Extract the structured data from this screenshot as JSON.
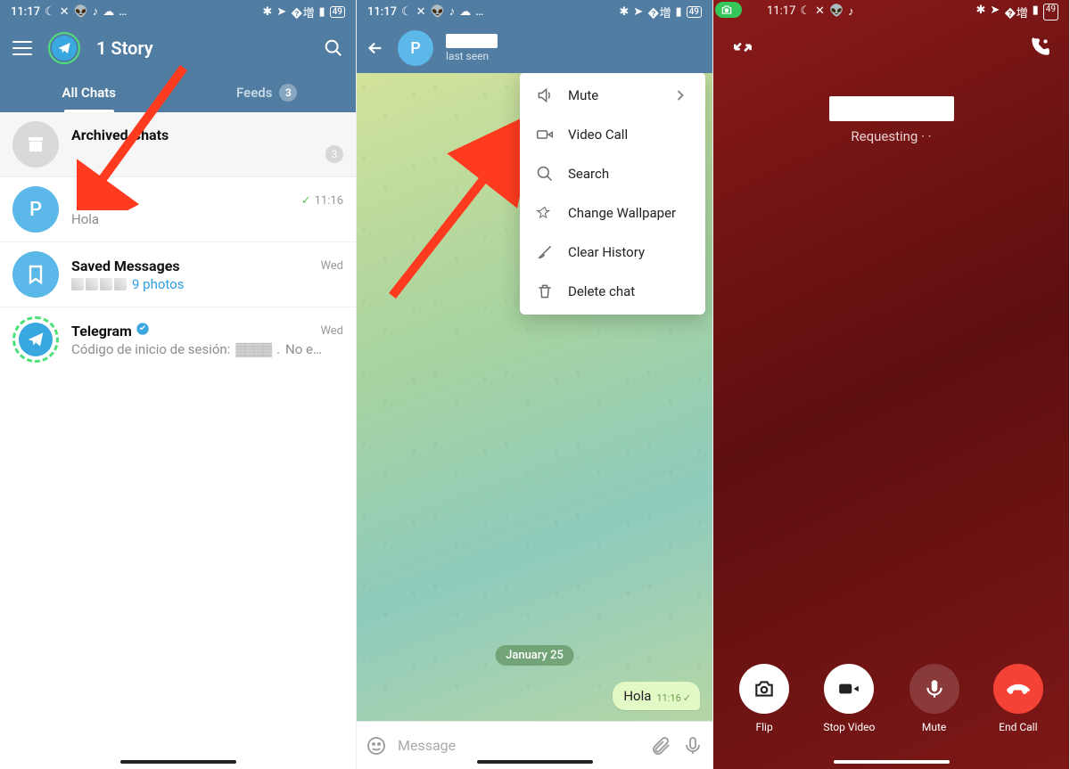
{
  "screen1": {
    "status": {
      "time": "11:17",
      "battery": "49"
    },
    "title": "1 Story",
    "tabs": {
      "all": "All Chats",
      "feeds": "Feeds",
      "feeds_count": "3"
    },
    "archived": {
      "title": "Archived Chats",
      "count": "3"
    },
    "chat_p": {
      "initial": "P",
      "msg": "Hola",
      "time": "11:16"
    },
    "saved": {
      "title": "Saved Messages",
      "sub": "9 photos",
      "time": "Wed"
    },
    "telegram": {
      "title": "Telegram",
      "sub": "Código de inicio de sesión:",
      "sub2": "No e…",
      "time": "Wed"
    }
  },
  "screen2": {
    "status": {
      "time": "11:17",
      "battery": "49"
    },
    "contact": {
      "initial": "P",
      "last_seen": "last seen"
    },
    "menu": {
      "mute": "Mute",
      "video": "Video Call",
      "search": "Search",
      "wallpaper": "Change Wallpaper",
      "clear": "Clear History",
      "delete": "Delete chat"
    },
    "date": "January 25",
    "bubble": {
      "text": "Hola",
      "time": "11:16"
    },
    "composer_placeholder": "Message"
  },
  "screen3": {
    "status": {
      "time": "11:17",
      "battery": "49"
    },
    "requesting": "Requesting · ·",
    "actions": {
      "flip": "Flip",
      "stop": "Stop Video",
      "mute": "Mute",
      "end": "End Call"
    }
  }
}
